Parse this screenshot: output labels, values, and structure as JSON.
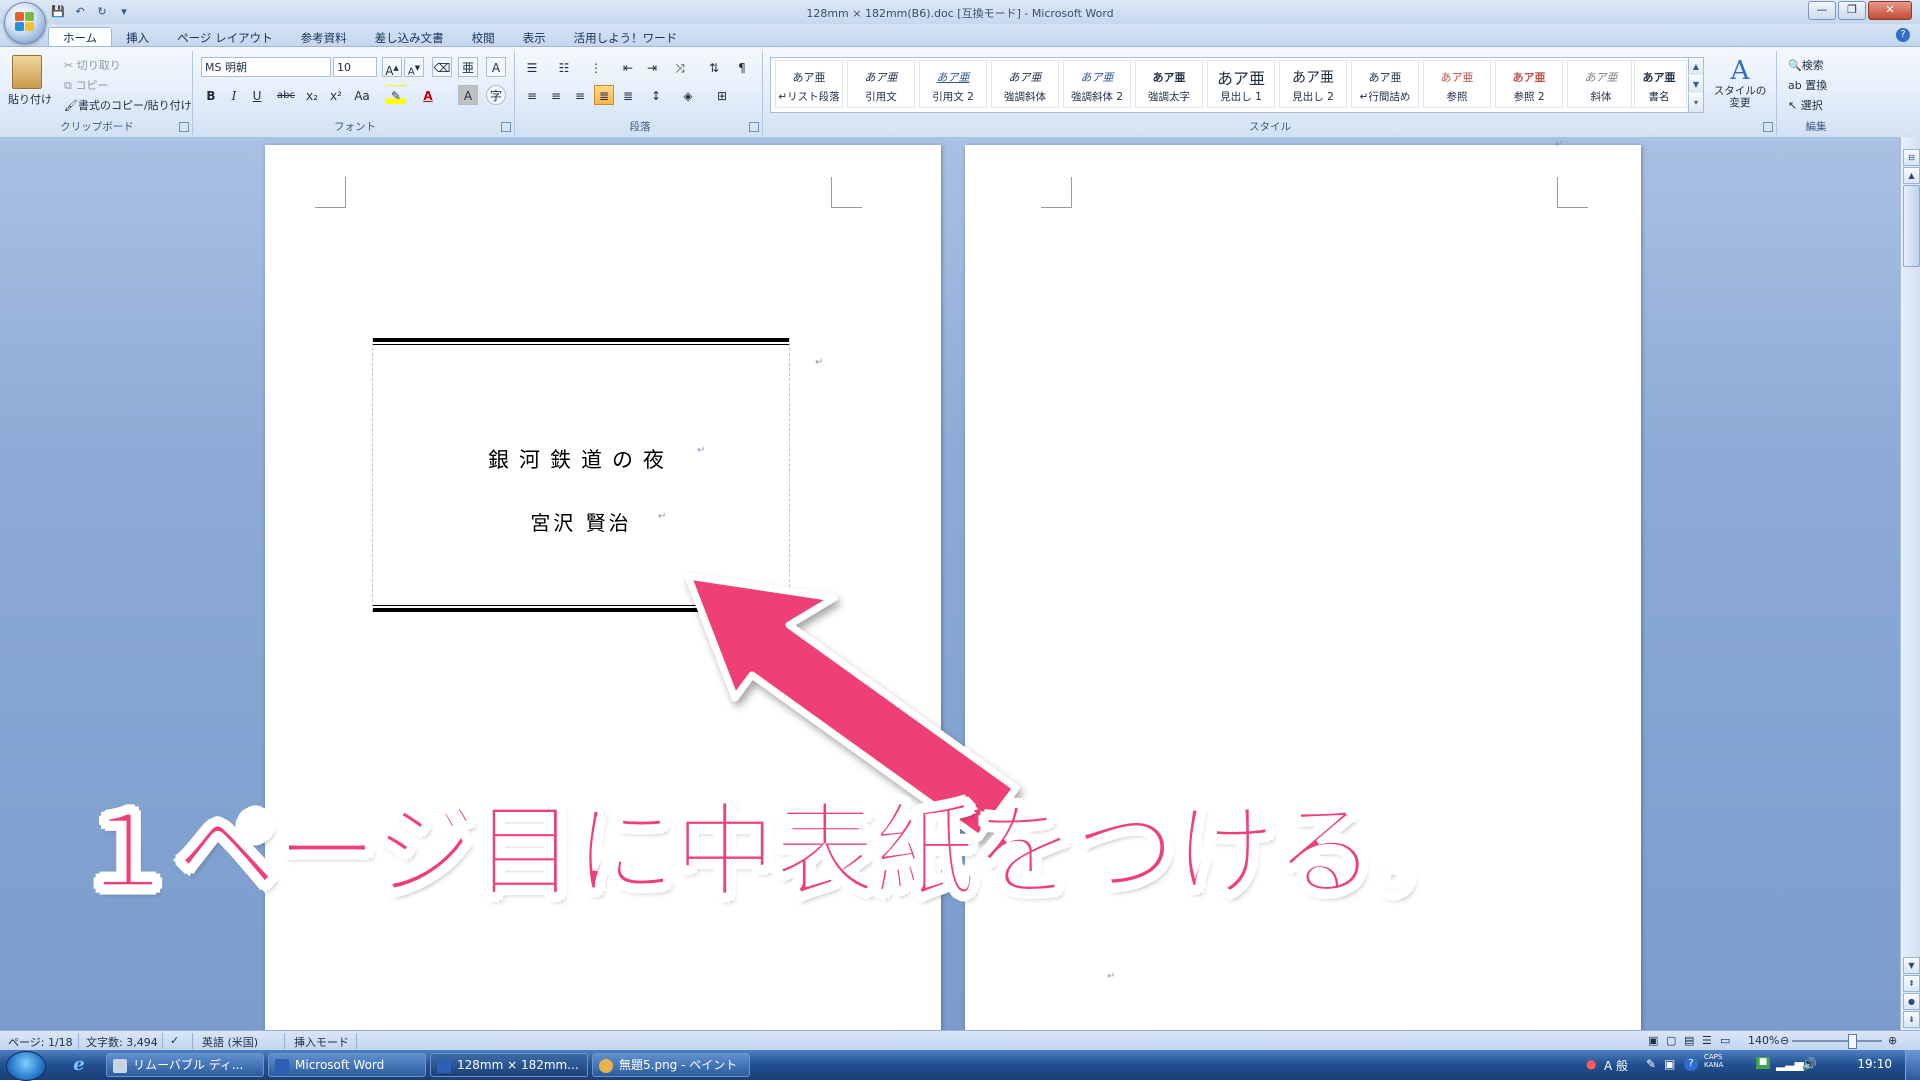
{
  "window": {
    "title": "128mm × 182mm(B6).doc [互換モード] - Microsoft Word",
    "controls": [
      "—",
      "❐",
      "✕"
    ]
  },
  "qat": {
    "save_icon": "💾",
    "undo_icon": "↶",
    "redo_icon": "↻",
    "customize_icon": "▾"
  },
  "tabs": [
    "ホーム",
    "挿入",
    "ページ レイアウト",
    "参考資料",
    "差し込み文書",
    "校閲",
    "表示",
    "活用しよう！ワード"
  ],
  "ribbon": {
    "clipboard": {
      "label": "クリップボード",
      "paste": "貼り付け",
      "cut": "切り取り",
      "copy": "コピー",
      "format_painter": "書式のコピー/貼り付け"
    },
    "font": {
      "label": "フォント",
      "font_name": "MS 明朝",
      "font_size": "10",
      "buttons": [
        "B",
        "I",
        "U",
        "abc",
        "x₂",
        "x²",
        "Aa"
      ]
    },
    "paragraph": {
      "label": "段落"
    },
    "styles": {
      "label": "スタイル",
      "change_styles": "スタイルの変更",
      "items": [
        {
          "sample": "あア亜",
          "name": "↵リスト段落",
          "color": "#000000"
        },
        {
          "sample": "あア亜",
          "name": "引用文",
          "color": "#000000"
        },
        {
          "sample": "あア亜",
          "name": "引用文 2",
          "color": "#2f5597"
        },
        {
          "sample": "あア亜",
          "name": "強調斜体",
          "color": "#000000"
        },
        {
          "sample": "あア亜",
          "name": "強調斜体 2",
          "color": "#2f5597"
        },
        {
          "sample": "あア亜",
          "name": "強調太字",
          "color": "#000000"
        },
        {
          "sample": "あア亜",
          "name": "見出し 1",
          "color": "#000000"
        },
        {
          "sample": "あア亜",
          "name": "見出し 2",
          "color": "#000000"
        },
        {
          "sample": "あア亜",
          "name": "↵行間詰め",
          "color": "#000000"
        },
        {
          "sample": "あア亜",
          "name": "参照",
          "color": "#c0504d"
        },
        {
          "sample": "あア亜",
          "name": "参照 2",
          "color": "#c0504d"
        },
        {
          "sample": "あア亜",
          "name": "斜体",
          "color": "#808080"
        },
        {
          "sample": "あア亜",
          "name": "書名",
          "color": "#000000"
        }
      ]
    },
    "editing": {
      "label": "編集",
      "find": "検索",
      "replace": "置換",
      "select": "選択"
    }
  },
  "document": {
    "title": "銀河鉄道の夜",
    "author": "宮沢 賢治",
    "para_mark": "↵"
  },
  "annotation": {
    "text": "１ページ目に中表紙をつける。",
    "color": "#ef3f74"
  },
  "statusbar": {
    "page": "ページ: 1/18",
    "words": "文字数: 3,494",
    "language": "英語 (米国)",
    "mode": "挿入モード",
    "zoom": "140%"
  },
  "taskbar": {
    "items": [
      "リムーバブル ディ...",
      "Microsoft Word",
      "128mm × 182mm...",
      "無題5.png - ペイント"
    ],
    "ime": "A 般",
    "caps": "CAPS",
    "kana": "KANA",
    "clock": "19:10"
  }
}
